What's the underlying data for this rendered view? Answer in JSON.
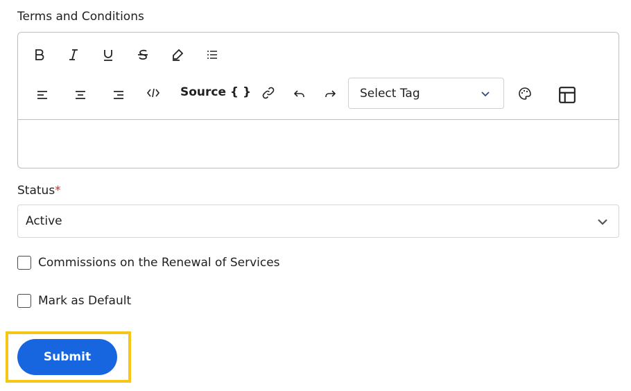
{
  "terms": {
    "label": "Terms and Conditions",
    "toolbar": {
      "row1": [
        "bold-icon",
        "italic-icon",
        "underline-icon",
        "strikethrough-icon",
        "highlighter-icon",
        "bullet-list-icon"
      ],
      "row2": [
        "align-left-icon",
        "align-center-icon",
        "align-right-icon",
        "code-icon"
      ],
      "source_label": "Source { }",
      "row2b": [
        "link-icon",
        "undo-icon",
        "redo-icon"
      ],
      "select_tag": "Select Tag",
      "row2c": [
        "palette-icon",
        "table-icon"
      ]
    },
    "content": ""
  },
  "status": {
    "label": "Status",
    "required_mark": "*",
    "value": "Active"
  },
  "checkboxes": [
    {
      "label": "Commissions on the Renewal of Services",
      "checked": false
    },
    {
      "label": "Mark as Default",
      "checked": false
    }
  ],
  "submit_label": "Submit",
  "colors": {
    "accent": "#1766e0",
    "highlight": "#f5c518",
    "required": "#e02424"
  }
}
